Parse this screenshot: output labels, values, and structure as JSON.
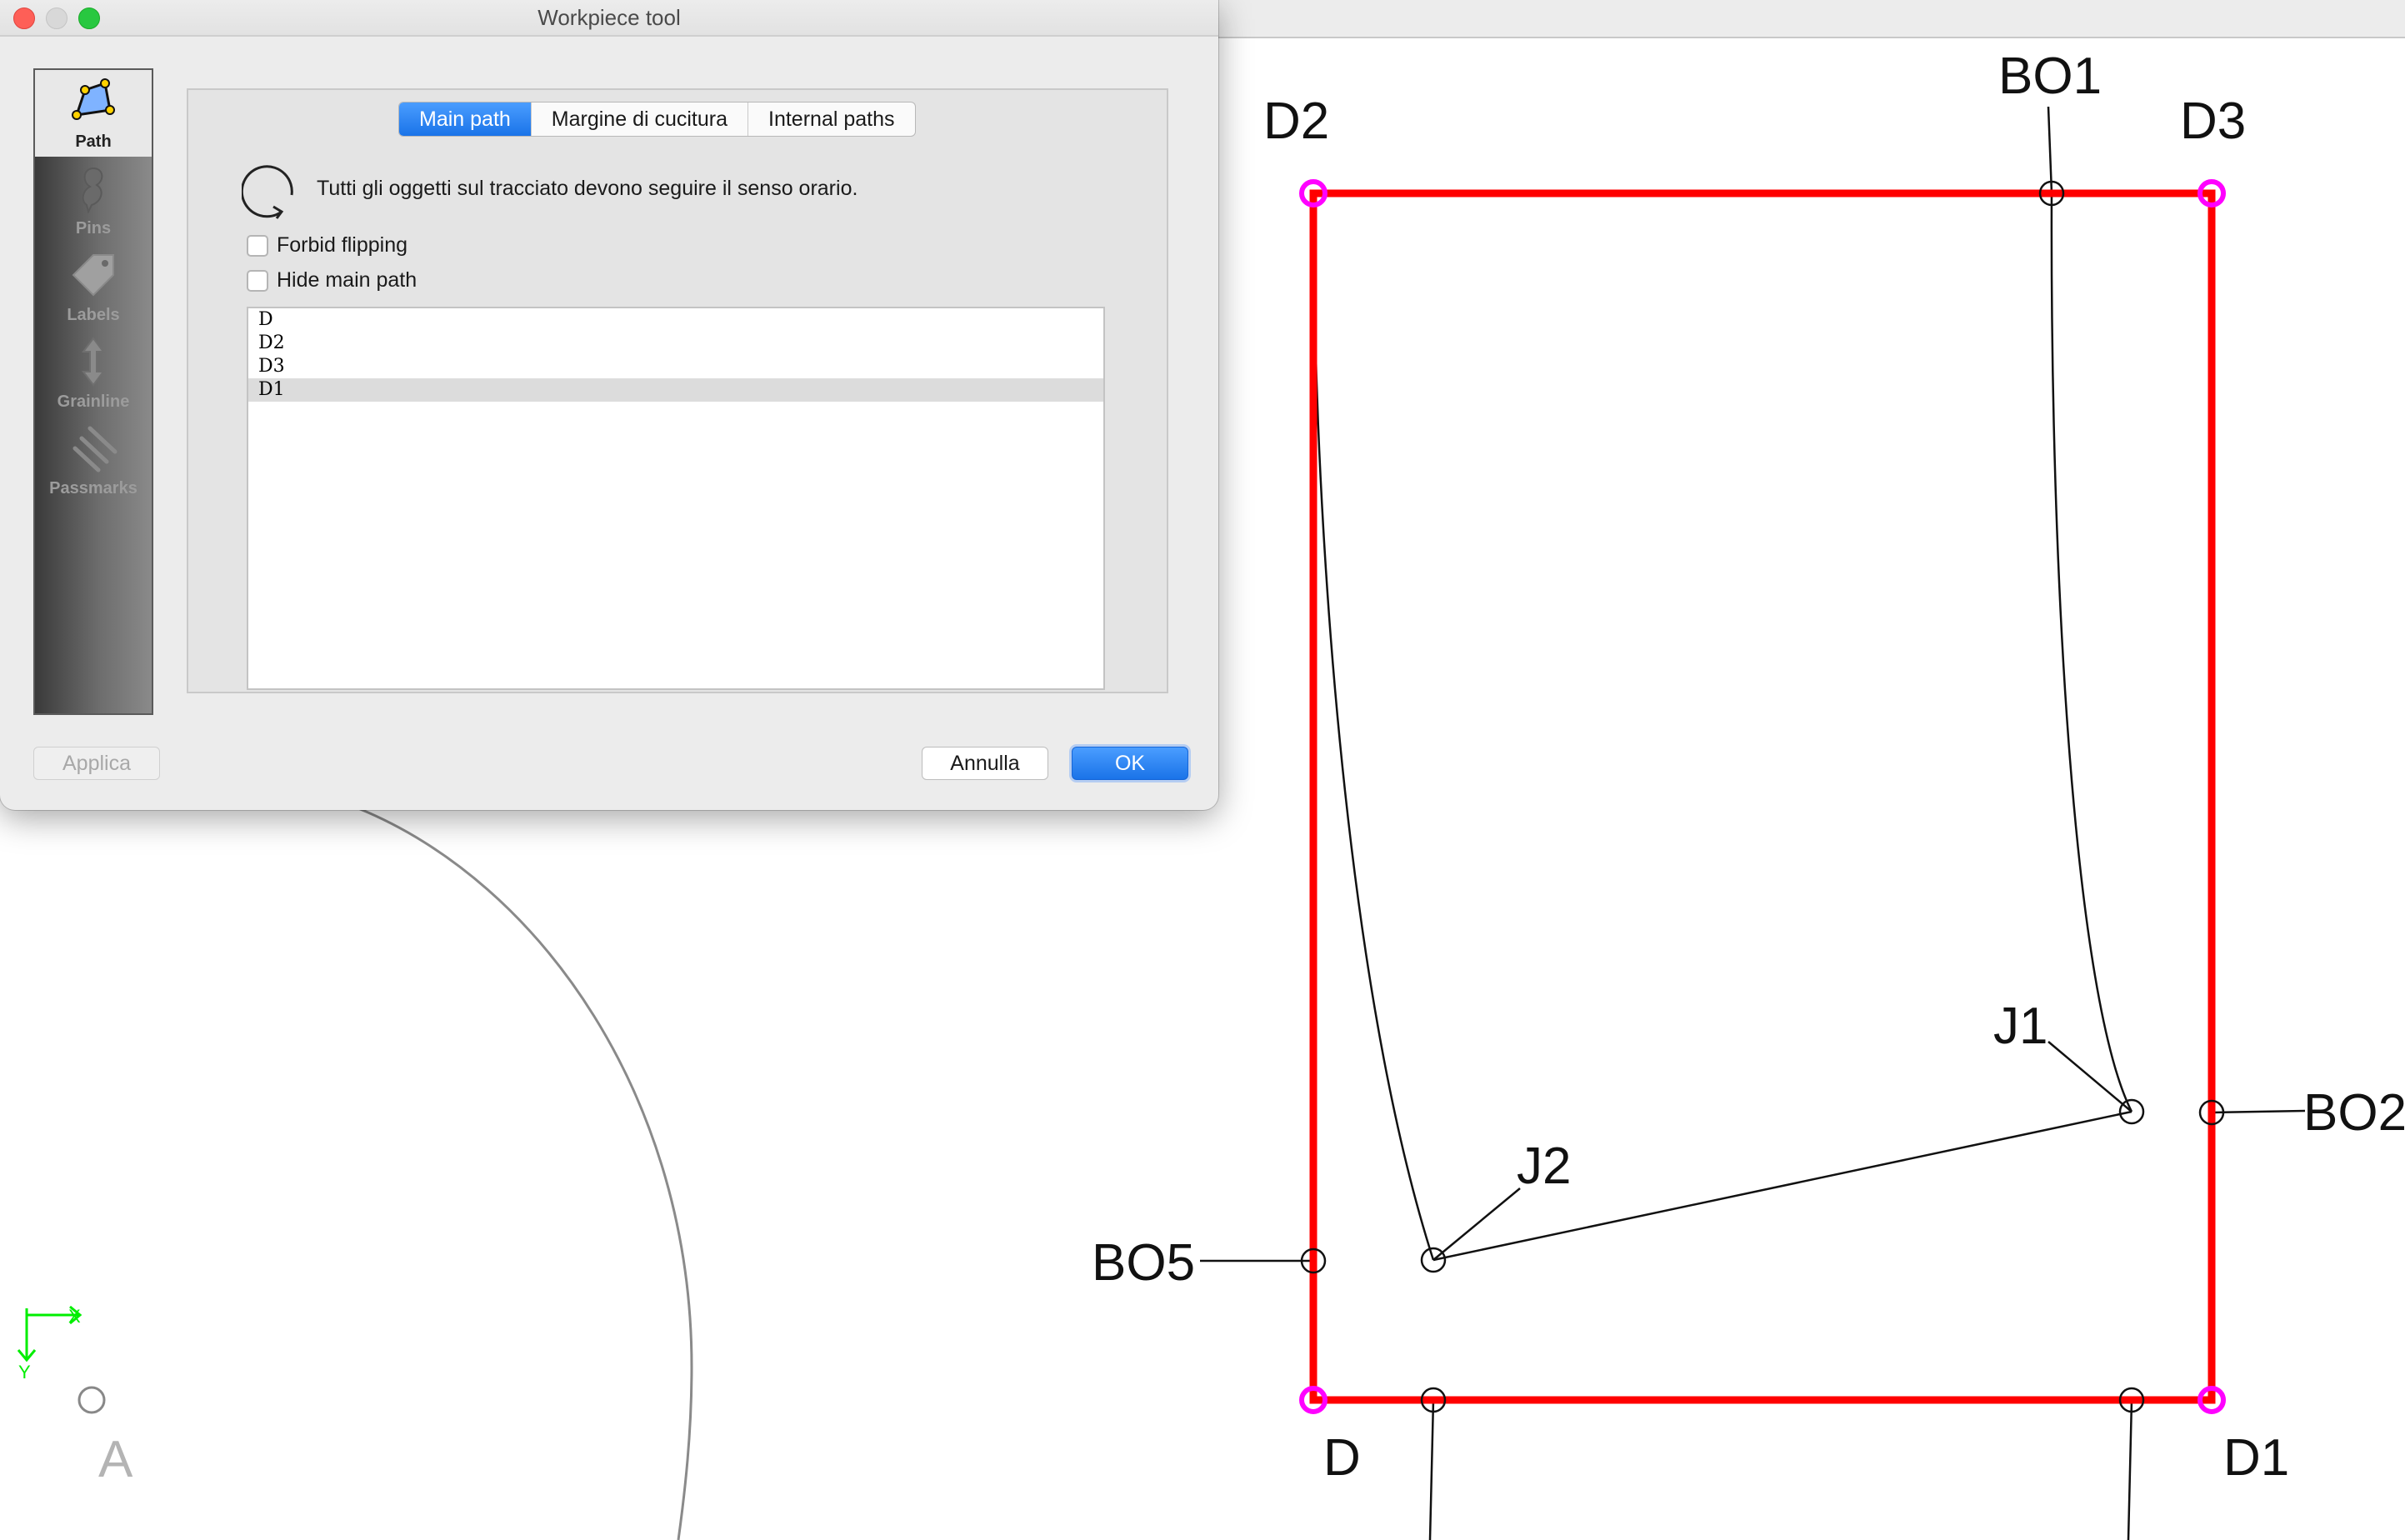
{
  "window": {
    "title": "Workpiece tool"
  },
  "sidebar": {
    "items": [
      {
        "label": "Path",
        "icon": "path-icon",
        "active": true
      },
      {
        "label": "Pins",
        "icon": "pin-icon",
        "active": false
      },
      {
        "label": "Labels",
        "icon": "label-tag-icon",
        "active": false
      },
      {
        "label": "Grainline",
        "icon": "grainline-arrow-icon",
        "active": false
      },
      {
        "label": "Passmarks",
        "icon": "passmarks-icon",
        "active": false
      }
    ]
  },
  "tabs": [
    {
      "label": "Main path",
      "active": true
    },
    {
      "label": "Margine di cucitura",
      "active": false
    },
    {
      "label": "Internal paths",
      "active": false
    }
  ],
  "main_path": {
    "orientation_text": "Tutti gli oggetti sul tracciato devono seguire il senso orario.",
    "forbid_flipping": {
      "label": "Forbid flipping",
      "checked": false
    },
    "hide_main_path": {
      "label": "Hide main path",
      "checked": false
    },
    "points": [
      "D",
      "D2",
      "D3",
      "D1"
    ],
    "selected_point": "D1"
  },
  "buttons": {
    "apply": "Applica",
    "cancel": "Annulla",
    "ok": "OK"
  },
  "canvas": {
    "axis_x": "X",
    "axis_y": "Y",
    "point_labels": {
      "D2": "D2",
      "D3": "D3",
      "BO1": "BO1",
      "J1": "J1",
      "BO2": "BO2",
      "J2": "J2",
      "BO5": "BO5",
      "D": "D",
      "D1": "D1",
      "A": "A"
    },
    "colors": {
      "main_path": "#ff0000",
      "corner_point": "#ff00ff",
      "axes": "#00ee00",
      "grey_label": "#b4b4b4"
    }
  }
}
